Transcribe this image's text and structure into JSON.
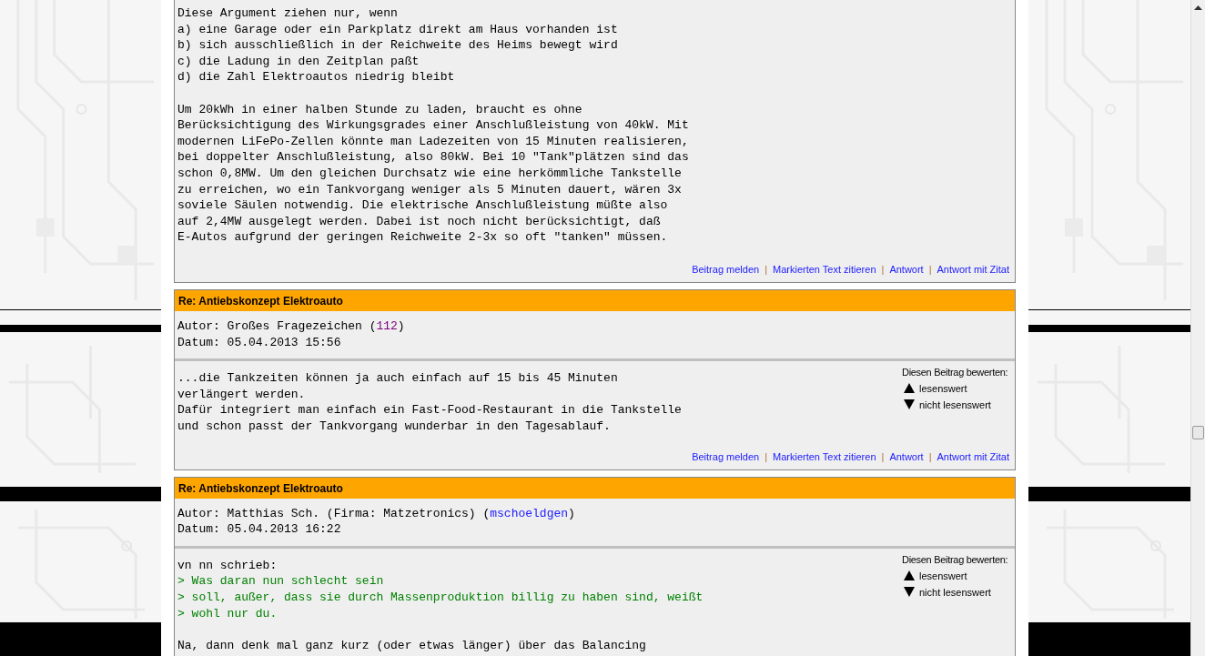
{
  "posts": [
    {
      "body": [
        {
          "kind": "text",
          "space_before": false,
          "lines": [
            "Diese Argument ziehen nur, wenn",
            "a) eine Garage oder ein Parkplatz direkt am Haus vorhanden ist",
            "b) sich ausschließlich in der Reichweite des Heims bewegt wird",
            "c) die Ladung in den Zeitplan paßt",
            "d) die Zahl Elektroautos niedrig bleibt"
          ]
        },
        {
          "kind": "text",
          "space_before": true,
          "lines": [
            "Um 20kWh in einer halben Stunde zu laden, braucht es ohne",
            "Berücksichtigung des Wirkungsgrades einer Anschlußleistung von 40kW. Mit",
            "modernen LiFePo-Zellen könnte man Ladezeiten von 15 Minuten realisieren,",
            "bei doppelter Anschlußleistung, also 80kW. Bei 10 \"Tank\"plätzen sind das",
            "schon 0,8MW. Um den gleichen Durchsatz wie eine herkömmliche Tankstelle",
            "zu erreichen, wo ein Tankvorgang weniger als 5 Minuten dauert, wären 3x",
            "soviele Säulen notwendig. Die elektrische Anschlußleistung müßte also",
            "auf 2,4MW ausgelegt werden. Dabei ist noch nicht berücksichtigt, daß",
            "E-Autos aufgrund der geringen Reichweite 2-3x so oft \"tanken\" müssen."
          ]
        }
      ],
      "actions": [
        {
          "kind": "link",
          "label": "Beitrag melden"
        },
        {
          "kind": "separator",
          "label": "|"
        },
        {
          "kind": "link",
          "label": "Markierten Text zitieren"
        },
        {
          "kind": "separator",
          "label": "|"
        },
        {
          "kind": "link",
          "label": "Antwort"
        },
        {
          "kind": "separator",
          "label": "|"
        },
        {
          "kind": "link",
          "label": "Antwort mit Zitat"
        }
      ]
    },
    {
      "title": "Re: Antiebskonzept Elektroauto",
      "author": {
        "prefix": "Autor: Großes Fragezeichen (",
        "user": "112",
        "visited": true,
        "suffix": ")"
      },
      "date": "Datum: 05.04.2013 15:56",
      "rating": {
        "label": "Diesen Beitrag bewerten:",
        "up": "lesenswert",
        "down": "nicht lesenswert"
      },
      "body": [
        {
          "kind": "text",
          "space_before": false,
          "lines": [
            "...die Tankzeiten können ja auch einfach auf 15 bis 45 Minuten",
            "verlängert werden.",
            "Dafür integriert man einfach ein Fast-Food-Restaurant in die Tankstelle",
            "und schon passt der Tankvorgang wunderbar in den Tagesablauf."
          ]
        }
      ],
      "actions": [
        {
          "kind": "link",
          "label": "Beitrag melden"
        },
        {
          "kind": "separator",
          "label": "|"
        },
        {
          "kind": "link",
          "label": "Markierten Text zitieren"
        },
        {
          "kind": "separator",
          "label": "|"
        },
        {
          "kind": "link",
          "label": "Antwort"
        },
        {
          "kind": "separator",
          "label": "|"
        },
        {
          "kind": "link",
          "label": "Antwort mit Zitat"
        }
      ]
    },
    {
      "title": "Re: Antiebskonzept Elektroauto",
      "author": {
        "prefix": "Autor: Matthias Sch. (Firma: Matzetronics) (",
        "user": "mschoeldgen",
        "visited": false,
        "suffix": ")"
      },
      "date": "Datum: 05.04.2013 16:22",
      "rating": {
        "label": "Diesen Beitrag bewerten:",
        "up": "lesenswert",
        "down": "nicht lesenswert"
      },
      "body": [
        {
          "kind": "text",
          "space_before": false,
          "lines": [
            "vn nn schrieb:"
          ]
        },
        {
          "kind": "quote",
          "space_before": false,
          "lines": [
            "> Was daran nun schlecht sein",
            "> soll, außer, dass sie durch Massenproduktion billig zu haben sind, weißt",
            "> wohl nur du."
          ]
        },
        {
          "kind": "text",
          "space_before": true,
          "lines": [
            "Na, dann denk mal ganz kurz (oder etwas länger) über das Balancing"
          ]
        }
      ]
    }
  ]
}
